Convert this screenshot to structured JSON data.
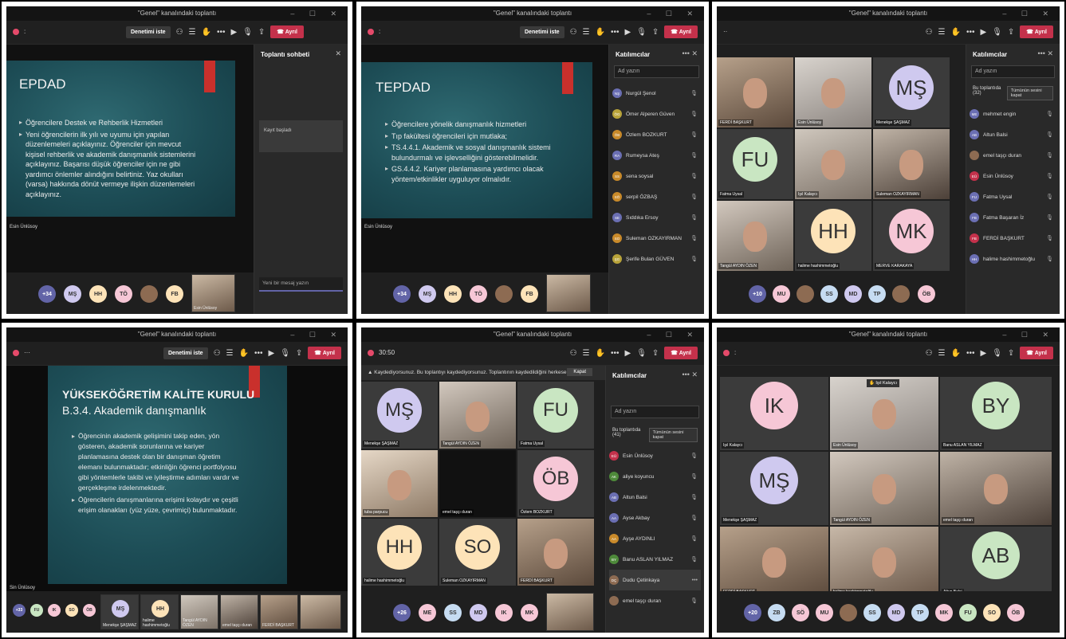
{
  "common": {
    "title": "\"Genel\" kanalındaki toplantı",
    "stop_share": "Denetimi iste",
    "leave": "Ayrıl",
    "participants_title": "Katılımcılar",
    "search_placeholder": "Ad yazın",
    "in_meeting": "Bu toplantıda",
    "mute_all": "Tümünün sesini kapat"
  },
  "p1": {
    "slide_title": "EPDAD",
    "bullets": [
      "Öğrencilere Destek ve Rehberlik Hizmetleri",
      "Yeni öğrencilerin ilk yılı ve uyumu için yapılan düzenlemeleri açıklayınız. Öğrenciler için mevcut kişisel rehberlik ve akademik danışmanlık sistemlerini açıklayınız. Başarısı düşük öğrenciler için ne gibi yardımcı önlemler alındığını belirtiniz. Yaz okulları (varsa) hakkında dönüt vermeye ilişkin düzenlemeleri açıklayınız."
    ],
    "presenter": "Esin Ünlüsoy",
    "chat_title": "Toplantı sohbeti",
    "chat_card": "Kayıt başladı",
    "chat_input": "Yeni bir mesaj yazın",
    "avatars": [
      "+34",
      "MŞ",
      "HH",
      "TÖ",
      "",
      "FB"
    ],
    "self_label": "Esin Ünlüsoy"
  },
  "p2": {
    "slide_title": "TEPDAD",
    "bullets": [
      "Öğrencilere yönelik danışmanlık hizmetleri",
      "Tıp fakültesi öğrencileri için mutlaka;",
      "TS.4.4.1. Akademik ve sosyal danışmanlık sistemi bulundurmalı ve işlevselliğini gösterebilmelidir.",
      "GS.4.4.2. Kariyer planlamasına yardımcı olacak yöntem/etkinlikler uyguluyor olmalıdır."
    ],
    "presenter": "Esin Ünlüsoy",
    "participants": [
      "Nurgül Şenol",
      "Ömer Alperen Güven",
      "Özlem BOZKURT",
      "Rumeysa Ateş",
      "sena soysal",
      "serpil ÖZBAŞ",
      "Sıddıka Ersoy",
      "Suleman OZKAYIRMAN",
      "Şerife Bulan GÜVEN"
    ],
    "initials": [
      "NŞ",
      "ÖG",
      "ÖB",
      "RA",
      "SS",
      "SÖ",
      "SE",
      "SO",
      "ŞG"
    ],
    "avatars": [
      "+34",
      "MŞ",
      "HH",
      "TÖ",
      "",
      "FB"
    ]
  },
  "p3": {
    "tiles": [
      {
        "label": "FERDİ BAŞKURT",
        "initials": ""
      },
      {
        "label": "Esin Ünlüsoy",
        "initials": ""
      },
      {
        "label": "Menekşe ŞAŞMAZ",
        "initials": "MŞ"
      },
      {
        "label": "Fatma Uysal",
        "initials": "FU"
      },
      {
        "label": "Işıl Kalaycı",
        "initials": ""
      },
      {
        "label": "Suleman OZKAYIRMAN",
        "initials": ""
      },
      {
        "label": "Tangül AYDIN ÖZEN",
        "initials": ""
      },
      {
        "label": "halime hashimmetoğlu",
        "initials": "HH"
      },
      {
        "label": "MERVE KARAKAYA",
        "initials": "MK"
      }
    ],
    "participants": [
      "mehmet engin",
      "Altun Balsi",
      "emel taşçı duran",
      "Esin Ünlüsoy",
      "Fatma Uysal",
      "Fatma Başaran İz",
      "FERDİ BAŞKURT",
      "halime hashimmetoğlu"
    ],
    "initials": [
      "ME",
      "AB",
      "",
      "EÜ",
      "FU",
      "FB",
      "FB",
      "HH"
    ],
    "count": "(32)",
    "avatars": [
      "+10",
      "MU",
      "",
      "SS",
      "MD",
      "TP",
      "",
      "ÖB"
    ]
  },
  "p4": {
    "slide_title": "YÜKSEKÖĞRETİM KALİTE KURULU",
    "slide_subtitle": "B.3.4. Akademik danışmanlık",
    "bullets": [
      "Öğrencinin akademik gelişimini takip eden, yön gösteren, akademik sorunlarına ve kariyer planlamasına destek olan bir danışman öğretim elemanı bulunmaktadır; etkinliğin öğrenci portfolyosu gibi yöntemlerle takibi ve iyileştirme adımları vardır ve gerçekleşme irdelenmektedir.",
      "Öğrencilerin danışmanlarına erişimi kolaydır ve çeşitli erişim olanakları (yüz yüze, çevrimiçi) bulunmaktadır."
    ],
    "presenter": "Sin Ünlüsoy",
    "avatars": [
      "+33",
      "FU",
      "IK",
      "SO",
      "ÖB"
    ],
    "strip": [
      "Menekşe ŞAŞMAZ",
      "halime hashimmetoğlu",
      "Tangül AYDIN ÖZEN",
      "emel taşçı duran",
      "FERDİ BAŞKURT"
    ]
  },
  "p5": {
    "time": "30:50",
    "rec_notice": "Kaydediyorsunuz. Bu toplantıyı kaydediyorsunuz. Toplantının kaydedildiğini herkese bildirdiğ...",
    "rec_close": "Kapat",
    "tiles": [
      {
        "label": "Menekşe ŞAŞMAZ",
        "initials": "MŞ"
      },
      {
        "label": "Tangül AYDIN ÖZEN",
        "initials": ""
      },
      {
        "label": "Fatma Uysal",
        "initials": "FU"
      },
      {
        "label": "tuba parpucu",
        "initials": ""
      },
      {
        "label": "emel taşçı duran",
        "initials": ""
      },
      {
        "label": "Özlem BOZKURT",
        "initials": "ÖB"
      },
      {
        "label": "halime hashimmetoğlu",
        "initials": "HH"
      },
      {
        "label": "Suleman OZKAYIRMAN",
        "initials": "SO"
      },
      {
        "label": "FERDİ BAŞKURT",
        "initials": ""
      }
    ],
    "participants": [
      "Esin Ünlüsoy",
      "aliye koyuncu",
      "Altun Balsi",
      "Ayse Akbay",
      "Ayşe AYDINLI",
      "Banu ASLAN YILMAZ",
      "Dudu Çetinkaya",
      "emel taşçı duran"
    ],
    "initials": [
      "EÜ",
      "AK",
      "AB",
      "AA",
      "AA",
      "BY",
      "DÇ",
      ""
    ],
    "count": "(41)",
    "avatars": [
      "+26",
      "ME",
      "SS",
      "MD",
      "IK",
      "MK"
    ]
  },
  "p6": {
    "tiles": [
      {
        "label": "Işıl Kalaycı",
        "initials": "IK"
      },
      {
        "label": "Esin Ünlüsoy",
        "initials": ""
      },
      {
        "label": "Banu ASLAN YILMAZ",
        "initials": "BY"
      },
      {
        "label": "Menekşe ŞAŞMAZ",
        "initials": "MŞ"
      },
      {
        "label": "Tangül AYDIN ÖZEN",
        "initials": ""
      },
      {
        "label": "emel taşçı duran",
        "initials": ""
      },
      {
        "label": "FERDİ BAŞKURT",
        "initials": ""
      },
      {
        "label": "halime hashimmetoğlu",
        "initials": ""
      },
      {
        "label": "Altun Balsi",
        "initials": "AB"
      }
    ],
    "hand_label": "Işıl Kalaycı",
    "avatars": [
      "+20",
      "ZB",
      "SÖ",
      "MU",
      "",
      "SS",
      "MD",
      "TP",
      "MK",
      "FU",
      "SO",
      "ÖB"
    ]
  },
  "colors": {
    "accent": "#6264a7",
    "leave_red": "#c4314b",
    "slide_teal": "#1d4d56",
    "av_purple": "#cfc9ef",
    "av_peach": "#fde3b8",
    "av_pink": "#f6c7d6",
    "av_green": "#c9e6c2",
    "av_blue": "#c6dcf2"
  }
}
